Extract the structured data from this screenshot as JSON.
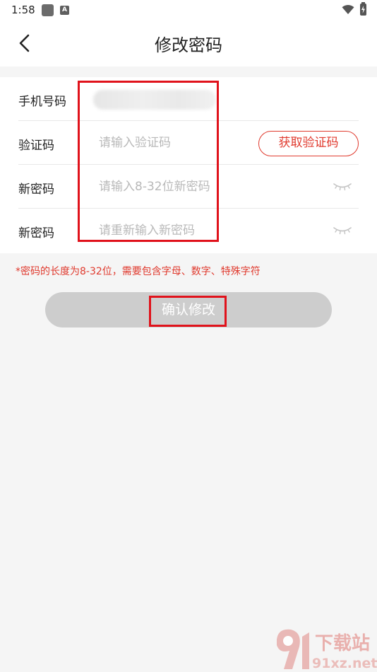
{
  "status_bar": {
    "time": "1:58",
    "app_icon": "square-app-icon",
    "notification_icon": "a-letter-icon",
    "wifi_icon": "wifi-icon",
    "battery_icon": "battery-charging-icon"
  },
  "header": {
    "back_icon": "chevron-left-icon",
    "title": "修改密码"
  },
  "form": {
    "phone": {
      "label": "手机号码",
      "value_blurred": true
    },
    "code": {
      "label": "验证码",
      "placeholder": "请输入验证码",
      "button_label": "获取验证码"
    },
    "new_password": {
      "label": "新密码",
      "placeholder": "请输入8-32位新密码",
      "toggle_icon": "eye-closed-icon"
    },
    "confirm_password": {
      "label": "新密码",
      "placeholder": "请重新输入新密码",
      "toggle_icon": "eye-closed-icon"
    }
  },
  "hint": "*密码的长度为8-32位，需要包含字母、数字、特殊字符",
  "confirm_button": "确认修改",
  "watermark": {
    "brand": "下载站",
    "domain": "91xz.net"
  },
  "colors": {
    "accent": "#e03a2e",
    "annotation": "#e0121b",
    "button_disabled": "#cdcdcd",
    "placeholder": "#b9b9b9",
    "background": "#f5f5f5"
  }
}
